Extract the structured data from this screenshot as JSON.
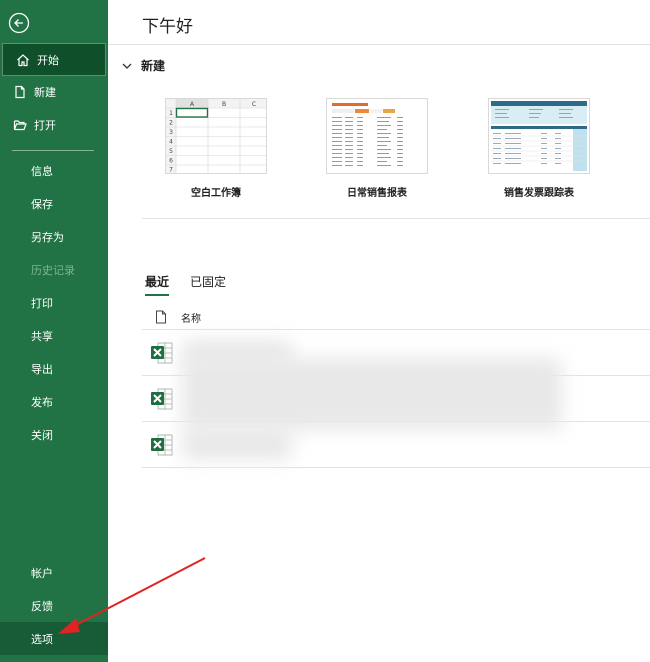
{
  "sidebar": {
    "nav_top": [
      {
        "label": "开始",
        "icon": "home-icon",
        "active": true
      },
      {
        "label": "新建",
        "icon": "new-file-icon"
      },
      {
        "label": "打开",
        "icon": "open-folder-icon"
      }
    ],
    "nav_mid": [
      {
        "label": "信息"
      },
      {
        "label": "保存"
      },
      {
        "label": "另存为"
      },
      {
        "label": "历史记录",
        "disabled": true
      },
      {
        "label": "打印"
      },
      {
        "label": "共享"
      },
      {
        "label": "导出"
      },
      {
        "label": "发布"
      },
      {
        "label": "关闭"
      }
    ],
    "nav_bottom": [
      {
        "label": "帐户"
      },
      {
        "label": "反馈"
      },
      {
        "label": "选项",
        "selected": true
      }
    ],
    "color": "#217346"
  },
  "main": {
    "greeting": "下午好",
    "new_section": "新建",
    "templates": [
      {
        "caption": "空白工作簿"
      },
      {
        "caption": "日常销售报表"
      },
      {
        "caption": "销售发票跟踪表"
      }
    ],
    "blank_sheet": {
      "columns": [
        "A",
        "B",
        "C"
      ],
      "rows": [
        "1",
        "2",
        "3",
        "4",
        "5",
        "6",
        "7"
      ]
    },
    "tabs": [
      {
        "label": "最近",
        "active": true
      },
      {
        "label": "已固定"
      }
    ],
    "list_header": "名称"
  }
}
